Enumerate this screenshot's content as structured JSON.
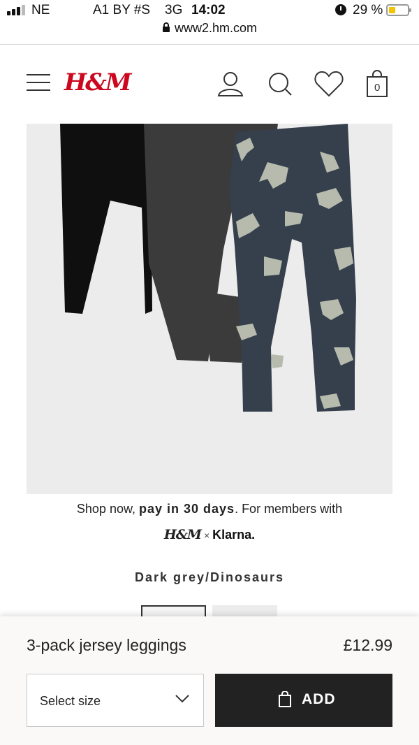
{
  "status_bar": {
    "carrier_left": "NE",
    "carrier_main": "A1 BY #S",
    "network": "3G",
    "time": "14:02",
    "battery": "29 %",
    "battery_level": 0.29,
    "battery_color": "#f5c400"
  },
  "browser": {
    "url": "www2.hm.com"
  },
  "header": {
    "logo": "H&M",
    "brand_color": "#cc071e",
    "bag_count": "0",
    "icons": [
      "menu-icon",
      "account-icon",
      "search-icon",
      "favorites-icon",
      "shopping-bag-icon"
    ]
  },
  "product_image": {
    "alt": "3-pack jersey leggings"
  },
  "klarna": {
    "text_before": "Shop now, ",
    "text_bold": "pay in 30 days",
    "text_after": ". For members with",
    "hm_logo": "H&M",
    "times": "×",
    "brand": "Klarna."
  },
  "product": {
    "color_name": "Dark grey/Dinosaurs",
    "name": "3-pack jersey leggings",
    "price": "£12.99"
  },
  "size_select": {
    "selected": "Select size"
  },
  "add_button": {
    "label": "ADD"
  }
}
